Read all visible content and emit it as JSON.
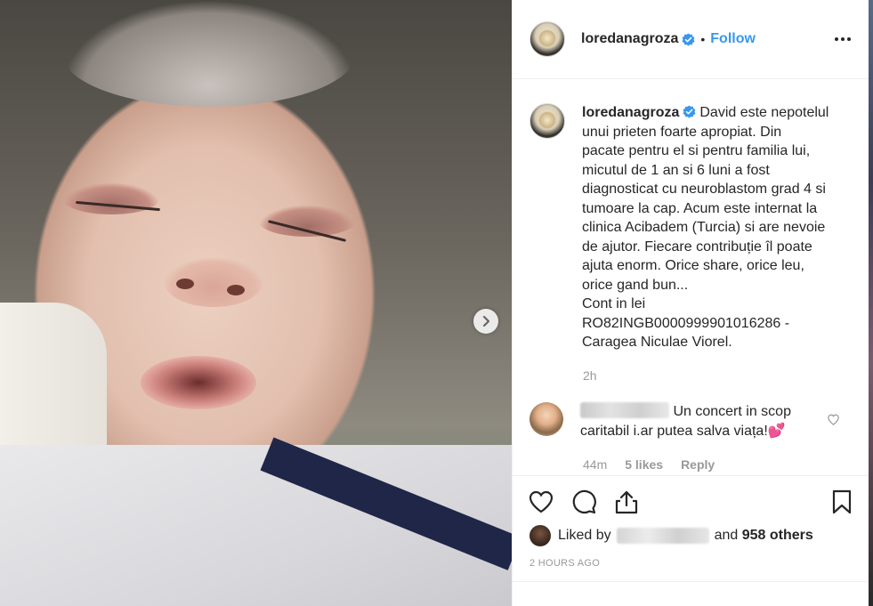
{
  "post": {
    "username": "loredanagroza",
    "follow_label": "Follow",
    "separator": "•",
    "caption_username": "loredanagroza",
    "caption_lines": [
      "David este nepotelul",
      "unui prieten foarte apropiat. Din",
      "pacate pentru el si pentru familia lui,",
      "micutul de 1 an si 6 luni a fost",
      "diagnosticat cu neuroblastom grad 4 si",
      "tumoare la cap. Acum este internat la",
      "clinica Acibadem (Turcia) si are nevoie",
      "de ajutor. Fiecare contribuție îl poate",
      "ajuta enorm. Orice share, orice leu,",
      "orice gand bun...",
      "Cont in lei",
      "RO82INGB0000999901016286 -",
      "Caragea Niculae Viorel."
    ],
    "caption_age": "2h"
  },
  "comment": {
    "text_line1": "Un concert in scop",
    "text_line2": "caritabil i.ar putea salva viața!💕",
    "age": "44m",
    "likes": "5 likes",
    "reply": "Reply"
  },
  "likes": {
    "prefix": "Liked by",
    "and_text": "and",
    "others": "958 others"
  },
  "posted_time": "2 HOURS AGO",
  "colors": {
    "accent": "#3897f0",
    "text": "#262626",
    "muted": "#999999"
  },
  "icons": {
    "verified": "verified-badge-icon",
    "more": "more-options-icon",
    "like": "heart-icon",
    "comment": "comment-bubble-icon",
    "share": "share-icon",
    "save": "bookmark-icon",
    "next": "chevron-right-icon"
  }
}
